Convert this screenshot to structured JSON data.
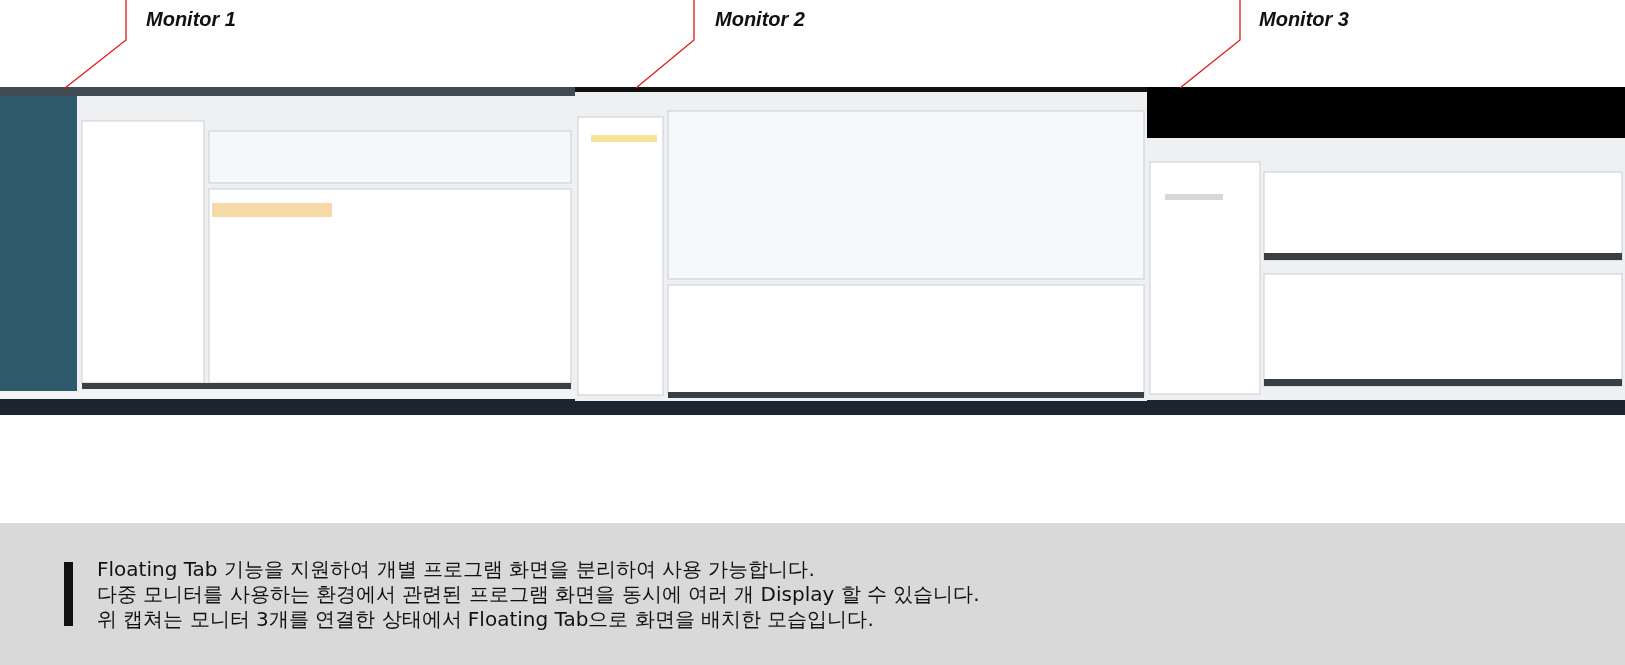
{
  "monitor_labels": [
    {
      "label": "Monitor 1"
    },
    {
      "label": "Monitor 2"
    },
    {
      "label": "Monitor 3"
    }
  ],
  "caption": {
    "lines": [
      "Floating Tab 기능을 지원하여 개별 프로그램 화면을 분리하여 사용 가능합니다.",
      "다중 모니터를 사용하는 환경에서 관련된 프로그램 화면을 동시에 여러 개 Display 할 수 있습니다.",
      "위 캡쳐는 모니터 3개를 연결한 상태에서 Floating Tab으로 화면을 배치한 모습입니다."
    ]
  }
}
